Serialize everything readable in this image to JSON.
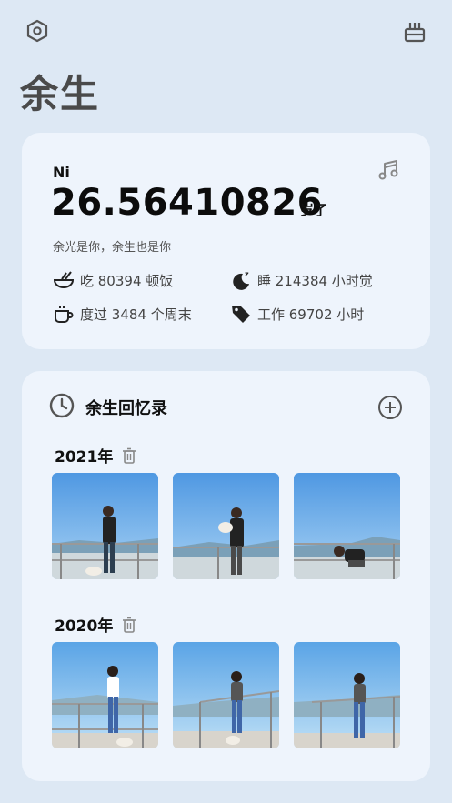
{
  "app": {
    "title": "余生"
  },
  "top_bar": {
    "left_icon": "hexagon-settings-icon",
    "right_icon": "cake-icon"
  },
  "profile": {
    "name": "Ni",
    "age": "26.56410826",
    "age_suffix": "岁了",
    "motto": "余光是你，余生也是你",
    "music_icon": "music-note-icon",
    "stats": [
      {
        "icon": "bowl-icon",
        "text": "吃 80394 顿饭"
      },
      {
        "icon": "moon-icon",
        "text": "睡 214384 小时觉"
      },
      {
        "icon": "cup-icon",
        "text": "度过 3484 个周末"
      },
      {
        "icon": "tag-icon",
        "text": "工作 69702 小时"
      }
    ]
  },
  "memories": {
    "title": "余生回忆录",
    "title_icon": "clock-icon",
    "add_icon": "plus-circle-icon",
    "groups": [
      {
        "year": "2021年",
        "photos": [
          "photo-man-with-dog",
          "photo-man-holding-dog",
          "photo-man-crouching"
        ]
      },
      {
        "year": "2020年",
        "photos": [
          "photo-woman-with-dog",
          "photo-woman-at-railing",
          "photo-woman-walking"
        ]
      }
    ]
  },
  "colors": {
    "background": "#dde8f4",
    "card": "#eef4fc",
    "icon": "#555555",
    "sky": "#5aa4e6"
  }
}
